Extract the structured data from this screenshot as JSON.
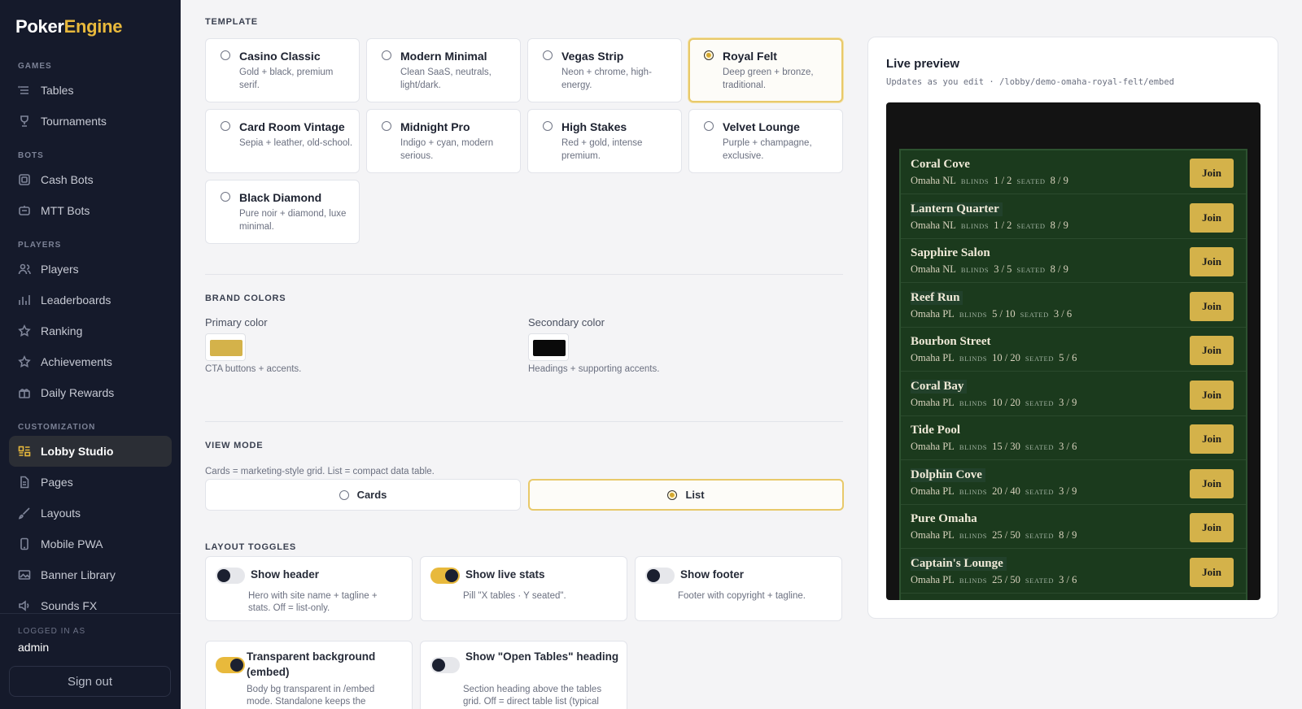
{
  "brand": {
    "part1": "Poker",
    "part2": "Engine"
  },
  "sidebar": {
    "sections": [
      {
        "label": "Games",
        "items": [
          {
            "label": "Tables",
            "icon": "list-icon"
          },
          {
            "label": "Tournaments",
            "icon": "trophy-icon"
          }
        ]
      },
      {
        "label": "Bots",
        "items": [
          {
            "label": "Cash Bots",
            "icon": "chip-icon"
          },
          {
            "label": "MTT Bots",
            "icon": "bot-icon"
          }
        ]
      },
      {
        "label": "Players",
        "items": [
          {
            "label": "Players",
            "icon": "users-icon"
          },
          {
            "label": "Leaderboards",
            "icon": "bar-chart-icon"
          },
          {
            "label": "Ranking",
            "icon": "star-icon"
          },
          {
            "label": "Achievements",
            "icon": "star-icon"
          },
          {
            "label": "Daily Rewards",
            "icon": "gift-icon"
          }
        ]
      },
      {
        "label": "Customization",
        "items": [
          {
            "label": "Lobby Studio",
            "icon": "layout-icon",
            "active": true
          },
          {
            "label": "Pages",
            "icon": "file-icon"
          },
          {
            "label": "Layouts",
            "icon": "brush-icon"
          },
          {
            "label": "Mobile PWA",
            "icon": "phone-icon"
          },
          {
            "label": "Banner Library",
            "icon": "image-icon"
          },
          {
            "label": "Sounds FX",
            "icon": "sound-icon"
          }
        ]
      }
    ],
    "logged_in_label": "Logged in as",
    "logged_in_user": "admin",
    "sign_out": "Sign out"
  },
  "template": {
    "title": "Template",
    "options": [
      {
        "name": "Casino Classic",
        "desc": "Gold + black, premium serif."
      },
      {
        "name": "Modern Minimal",
        "desc": "Clean SaaS, neutrals, light/dark."
      },
      {
        "name": "Vegas Strip",
        "desc": "Neon + chrome, high-energy."
      },
      {
        "name": "Royal Felt",
        "desc": "Deep green + bronze, traditional.",
        "selected": true
      },
      {
        "name": "Card Room Vintage",
        "desc": "Sepia + leather, old-school."
      },
      {
        "name": "Midnight Pro",
        "desc": "Indigo + cyan, modern serious."
      },
      {
        "name": "High Stakes",
        "desc": "Red + gold, intense premium."
      },
      {
        "name": "Velvet Lounge",
        "desc": "Purple + champagne, exclusive."
      },
      {
        "name": "Black Diamond",
        "desc": "Pure noir + diamond, luxe minimal."
      }
    ]
  },
  "brand_colors": {
    "title": "Brand colors",
    "primary_label": "Primary color",
    "primary_value": "#d4b24a",
    "primary_help": "CTA buttons + accents.",
    "secondary_label": "Secondary color",
    "secondary_value": "#0a0a0a",
    "secondary_help": "Headings + supporting accents."
  },
  "view_mode": {
    "title": "View mode",
    "help": "Cards = marketing-style grid. List = compact data table.",
    "cards_label": "Cards",
    "list_label": "List",
    "selected": "List"
  },
  "layout_toggles": {
    "title": "Layout toggles",
    "items": [
      {
        "title": "Show header",
        "desc": "Hero with site name + tagline + stats. Off = list-only.",
        "on": false
      },
      {
        "title": "Show live stats",
        "desc": "Pill \"X tables · Y seated\".",
        "on": true
      },
      {
        "title": "Show footer",
        "desc": "Footer with copyright + tagline.",
        "on": false
      },
      {
        "title": "Transparent background (embed)",
        "desc": "Body bg transparent in /embed mode. Standalone keeps the",
        "on": true
      },
      {
        "title": "Show \"Open Tables\" heading",
        "desc": "Section heading above the tables grid. Off = direct table list (typical",
        "on": false
      }
    ]
  },
  "preview": {
    "title": "Live preview",
    "subtitle": "Updates as you edit · /lobby/demo-omaha-royal-felt/embed",
    "blinds_label": "Blinds",
    "seated_label": "Seated",
    "join_label": "Join",
    "tables": [
      {
        "name": "Coral Cove",
        "game": "Omaha NL",
        "blinds": "1 / 2",
        "seated": "8 / 9"
      },
      {
        "name": "Lantern Quarter",
        "game": "Omaha NL",
        "blinds": "1 / 2",
        "seated": "8 / 9"
      },
      {
        "name": "Sapphire Salon",
        "game": "Omaha NL",
        "blinds": "3 / 5",
        "seated": "8 / 9"
      },
      {
        "name": "Reef Run",
        "game": "Omaha PL",
        "blinds": "5 / 10",
        "seated": "3 / 6"
      },
      {
        "name": "Bourbon Street",
        "game": "Omaha PL",
        "blinds": "10 / 20",
        "seated": "5 / 6"
      },
      {
        "name": "Coral Bay",
        "game": "Omaha PL",
        "blinds": "10 / 20",
        "seated": "3 / 9"
      },
      {
        "name": "Tide Pool",
        "game": "Omaha PL",
        "blinds": "15 / 30",
        "seated": "3 / 6"
      },
      {
        "name": "Dolphin Cove",
        "game": "Omaha PL",
        "blinds": "20 / 40",
        "seated": "3 / 9"
      },
      {
        "name": "Pure Omaha",
        "game": "Omaha PL",
        "blinds": "25 / 50",
        "seated": "8 / 9"
      },
      {
        "name": "Captain's Lounge",
        "game": "Omaha PL",
        "blinds": "25 / 50",
        "seated": "3 / 6"
      }
    ]
  }
}
